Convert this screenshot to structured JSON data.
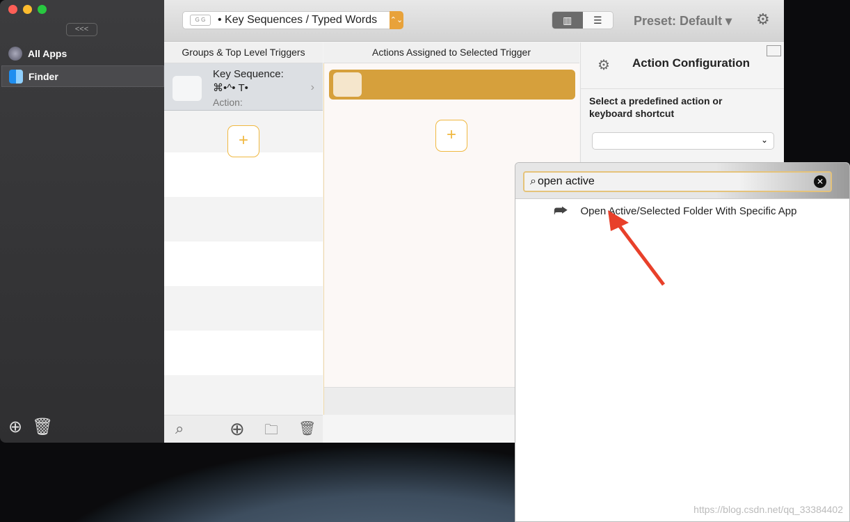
{
  "sidebar": {
    "collapse_label": "<<<",
    "apps": [
      {
        "label": "All Apps"
      },
      {
        "label": "Finder"
      }
    ]
  },
  "toolbar": {
    "trigger_type": "• Key Sequences / Typed Words",
    "trigger_icon_text": "G G",
    "preset": "Preset: Default ▾"
  },
  "columns": {
    "groups": "Groups & Top Level Triggers",
    "actions": "Actions Assigned to Selected Trigger"
  },
  "trigger": {
    "title": "Key Sequence:",
    "keys": "⌘•^• T•",
    "action": "Action:"
  },
  "config": {
    "title": "Action Configuration",
    "prompt": "Select a predefined action or keyboard shortcut",
    "dropdown_value": ""
  },
  "popup": {
    "search_value": "open active",
    "result": "Open Active/Selected Folder With Specific App"
  },
  "watermark": "https://blog.csdn.net/qq_33384402",
  "colors": {
    "accent": "#d6a03c",
    "plus": "#f0b840",
    "arrow": "#e8402a"
  }
}
